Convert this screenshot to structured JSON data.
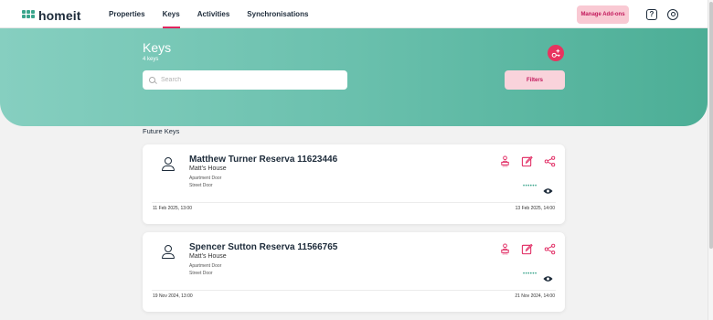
{
  "brand": {
    "name": "homeit",
    "color": "#3aa58c"
  },
  "nav": {
    "items": [
      {
        "label": "Properties",
        "active": false
      },
      {
        "label": "Keys",
        "active": true
      },
      {
        "label": "Activities",
        "active": false
      },
      {
        "label": "Synchronisations",
        "active": false
      }
    ],
    "manage_addons": "Manage Add-ons"
  },
  "header": {
    "title": "Keys",
    "count": "4 keys",
    "search_placeholder": "Search",
    "filters_label": "Filters"
  },
  "section": {
    "title": "Future Keys"
  },
  "keys": [
    {
      "name": "Matthew Turner Reserva 11623446",
      "house": "Matt's House",
      "door1": "Apartment Door",
      "door2": "Street Door",
      "code_mask": "••••••",
      "start": "11 Feb 2025, 13:00",
      "end": "13 Feb 2025, 14:00"
    },
    {
      "name": "Spencer Sutton Reserva 11566765",
      "house": "Matt's House",
      "door1": "Apartment Door",
      "door2": "Street Door",
      "code_mask": "••••••",
      "start": "19 Nov 2024, 13:00",
      "end": "21 Nov 2024, 14:00"
    }
  ],
  "colors": {
    "accent": "#e0245e",
    "teal": "#5bb9a4",
    "pink_button": "#f9c9d3"
  }
}
